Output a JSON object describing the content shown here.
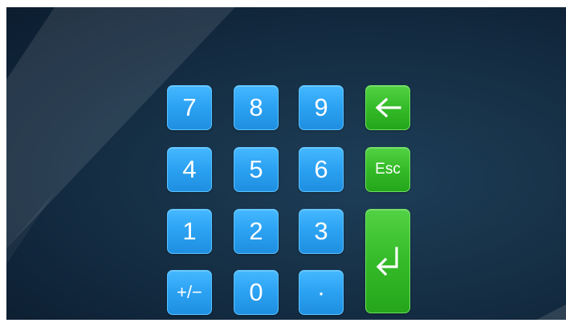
{
  "keypad": {
    "keys": [
      {
        "label": "7"
      },
      {
        "label": "8"
      },
      {
        "label": "9"
      },
      {
        "label": "4"
      },
      {
        "label": "5"
      },
      {
        "label": "6"
      },
      {
        "label": "1"
      },
      {
        "label": "2"
      },
      {
        "label": "3"
      },
      {
        "label": "+/−"
      },
      {
        "label": "0"
      },
      {
        "label": "·"
      }
    ],
    "esc_label": "Esc",
    "backspace_icon": "arrow-left-icon",
    "enter_icon": "enter-return-icon"
  },
  "colors": {
    "number_key": "#2da3f3",
    "function_key": "#35bb29",
    "background": "#173248"
  }
}
